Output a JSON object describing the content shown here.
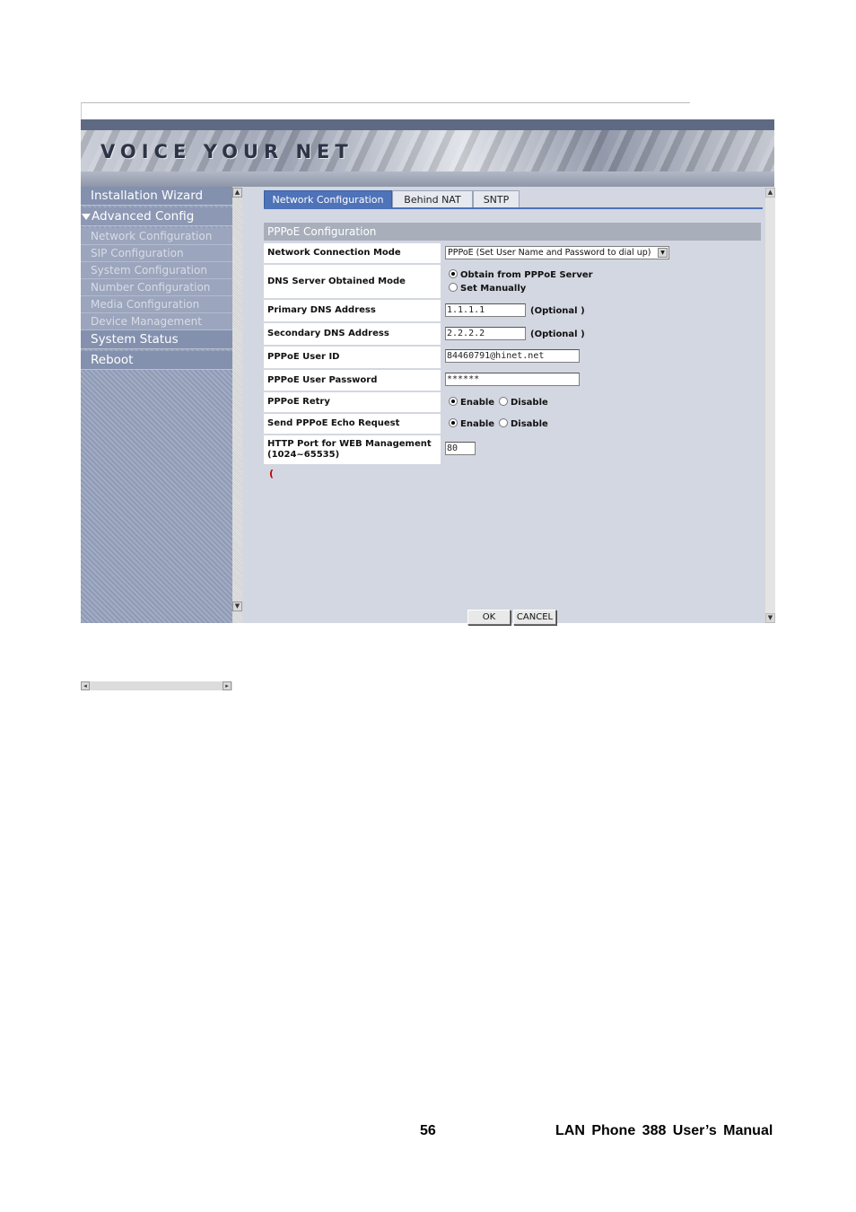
{
  "banner": {
    "title": "VOICE YOUR NET"
  },
  "sidebar": {
    "installation_wizard": "Installation Wizard",
    "advanced_config": "Advanced Config",
    "sub_items": [
      "Network Configuration",
      "SIP Configuration",
      "System Configuration",
      "Number Configuration",
      "Media Configuration",
      "Device Management"
    ],
    "system_status": "System Status",
    "reboot": "Reboot"
  },
  "tabs": [
    "Network Configuration",
    "Behind NAT",
    "SNTP"
  ],
  "section": {
    "title": "PPPoE Configuration"
  },
  "form": {
    "connection_mode": {
      "label": "Network Connection Mode",
      "value": "PPPoE (Set User Name and Password to dial up)"
    },
    "dns_mode": {
      "label": "DNS Server Obtained Mode",
      "options": [
        "Obtain from PPPoE Server",
        "Set Manually"
      ],
      "selected": "Obtain from PPPoE Server"
    },
    "primary_dns": {
      "label": "Primary DNS Address",
      "value": "1.1.1.1",
      "note": "(Optional )"
    },
    "secondary_dns": {
      "label": "Secondary DNS Address",
      "value": "2.2.2.2",
      "note": "(Optional )"
    },
    "user_id": {
      "label": "PPPoE User ID",
      "value": "84460791@hinet.net"
    },
    "password": {
      "label": "PPPoE User Password",
      "value": "******"
    },
    "retry": {
      "label": "PPPoE Retry",
      "options": [
        "Enable",
        "Disable"
      ],
      "selected": "Enable"
    },
    "echo": {
      "label": "Send PPPoE Echo Request",
      "options": [
        "Enable",
        "Disable"
      ],
      "selected": "Enable"
    },
    "http_port": {
      "label_line1": "HTTP Port for WEB Management",
      "label_line2": "(1024~65535)",
      "value": "80"
    }
  },
  "buttons": {
    "ok": "OK",
    "cancel": "CANCEL"
  },
  "footer": {
    "page_number": "56",
    "manual_title": "LAN Phone 388 User’s Manual"
  }
}
